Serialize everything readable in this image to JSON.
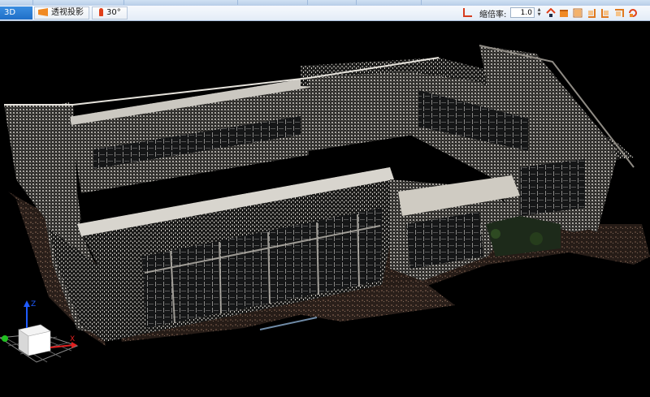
{
  "toolbar": {
    "tab_3d": "3D",
    "projection_button": "透视投影",
    "angle_button": "30°",
    "scale_label": "缩倍率:",
    "scale_value": "1.0",
    "spin_up": "▲",
    "spin_down": "▼"
  },
  "icons": {
    "projection": "perspective-projection-icon",
    "angle": "field-of-view-icon",
    "axis": "axis-scale-icon",
    "views": [
      "home-view-icon",
      "front-view-icon",
      "back-view-icon",
      "left-view-icon",
      "right-view-icon",
      "top-view-icon",
      "rotate-view-icon"
    ]
  },
  "axes_gizmo": {
    "z_label": "Z",
    "x_label": "X",
    "colors": {
      "z": "#1f5bff",
      "x": "#e02020",
      "y": "#20c020"
    }
  },
  "colors": {
    "accent": "#1f6fc8",
    "toolbar_bg": "#e8eff8",
    "viewport_bg": "#000000",
    "icon_orange": "#f08a24"
  }
}
